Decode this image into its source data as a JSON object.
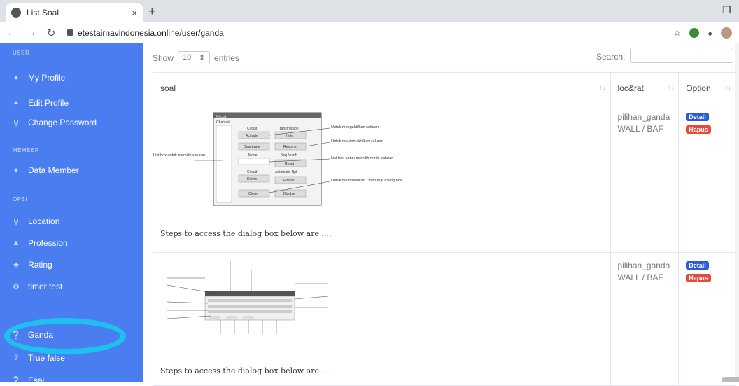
{
  "browser": {
    "tab_title": "List Soal",
    "tab_close": "×",
    "new_tab": "+",
    "url": "etestairnavindonesia.online/user/ganda"
  },
  "sidebar": {
    "sections": {
      "user": "USER",
      "member": "MEMBER",
      "opsi": "OPSI"
    },
    "items": [
      {
        "label": "My Profile",
        "icon": "user-icon"
      },
      {
        "label": "Edit Profile",
        "icon": "user-edit-icon"
      },
      {
        "label": "Change Password",
        "icon": "key-icon"
      },
      {
        "label": "Data Member",
        "icon": "users-icon"
      },
      {
        "label": "Location",
        "icon": "search-location-icon"
      },
      {
        "label": "Profession",
        "icon": "profession-icon"
      },
      {
        "label": "Rating",
        "icon": "star-icon"
      },
      {
        "label": "timer test",
        "icon": "gear-icon"
      },
      {
        "label": "Ganda",
        "icon": "question-circle-icon"
      },
      {
        "label": "True false",
        "icon": "question-icon"
      },
      {
        "label": "Esai",
        "icon": "question-circle-icon"
      }
    ]
  },
  "table": {
    "show_label": "Show",
    "entries_value": "10",
    "entries_label": "entries",
    "search_label": "Search:",
    "headers": [
      "soal",
      "loc&rat",
      "Option"
    ],
    "rows": [
      {
        "question": "Steps to access the dialog box below are ....",
        "loc_line1": "pilihan_ganda",
        "loc_line2": "WALL / BAF",
        "detail": "Detail",
        "hapus": "Hapus"
      },
      {
        "question": "Steps to access the dialog box below are ....",
        "loc_line1": "pilihan_ganda",
        "loc_line2": "WALL / BAF",
        "detail": "Detail",
        "hapus": "Hapus"
      }
    ]
  },
  "diagram1": {
    "window_title": "Circuit",
    "channel": "Channel",
    "circuit": "Circuit",
    "transmission": "Transmission",
    "activate": "Activate",
    "hold": "Hold",
    "deactivate": "Deactivate",
    "resume": "Resume",
    "mode": "Mode",
    "seq_numb": "Seq Numb.",
    "reset": "Reset",
    "automatic_rpt": "Automatic Rpt",
    "delete": "Delete",
    "enable": "Enable",
    "close": "Close",
    "disable": "Disable",
    "left_note": "List box untuk memilih saluran",
    "n1": "Untuk mengaktifkan saluran",
    "n2": "Untuk me-non-aktifkan saluran",
    "n3": "List box untuk memilih mode saluran",
    "n4": "Untuk membatalkan / menutup dialog box"
  },
  "colors": {
    "sidebar": "#4a7ef0",
    "highlight": "#1ec0f0",
    "detail": "#2a5bd7",
    "hapus": "#e74a3b"
  }
}
